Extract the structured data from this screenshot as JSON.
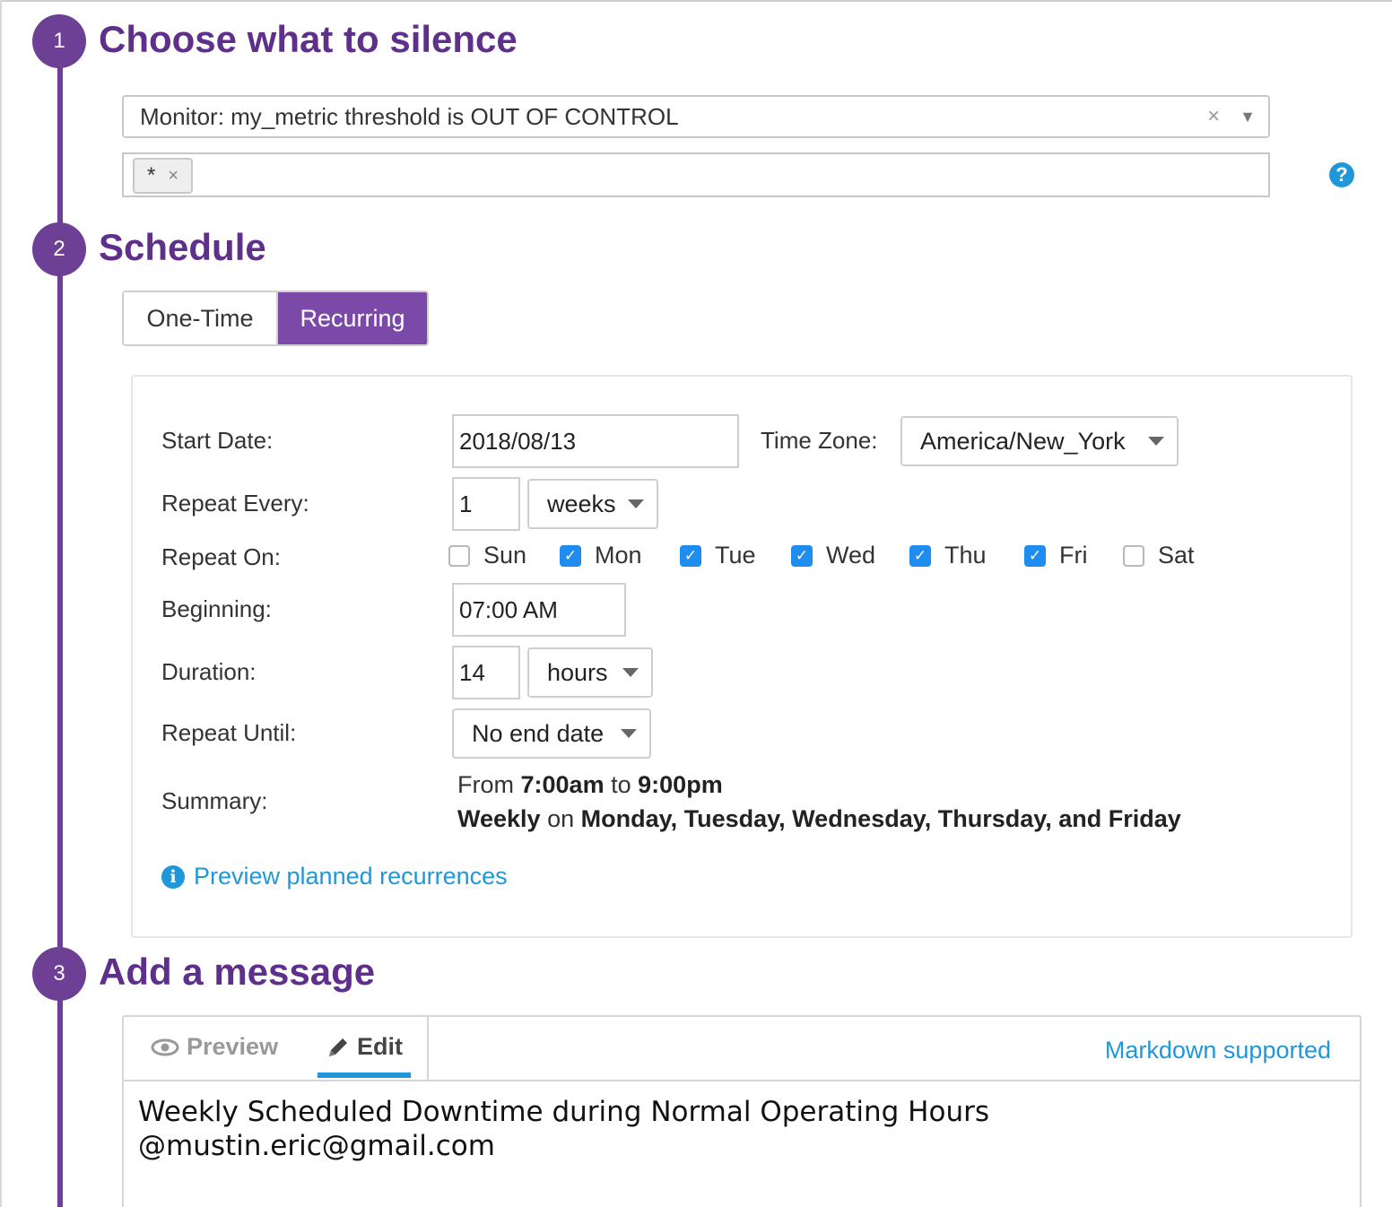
{
  "steps": [
    {
      "number": "1",
      "title": "Choose what to silence"
    },
    {
      "number": "2",
      "title": "Schedule"
    },
    {
      "number": "3",
      "title": "Add a message"
    }
  ],
  "silence": {
    "monitor_value": "Monitor: my_metric threshold is OUT OF CONTROL",
    "clear_icon": "×",
    "dropdown_icon": "▼",
    "scope_tag": "*",
    "scope_tag_remove": "×",
    "help_icon": "?"
  },
  "schedule": {
    "mode_tabs": [
      "One-Time",
      "Recurring"
    ],
    "active_tab": "Recurring",
    "labels": {
      "start_date": "Start Date:",
      "time_zone": "Time Zone:",
      "repeat_every": "Repeat Every:",
      "repeat_on": "Repeat On:",
      "beginning": "Beginning:",
      "duration": "Duration:",
      "repeat_until": "Repeat Until:",
      "summary": "Summary:"
    },
    "start_date": "2018/08/13",
    "time_zone": "America/New_York",
    "repeat_every_value": "1",
    "repeat_every_unit": "weeks",
    "days": [
      {
        "label": "Sun",
        "checked": false
      },
      {
        "label": "Mon",
        "checked": true
      },
      {
        "label": "Tue",
        "checked": true
      },
      {
        "label": "Wed",
        "checked": true
      },
      {
        "label": "Thu",
        "checked": true
      },
      {
        "label": "Fri",
        "checked": true
      },
      {
        "label": "Sat",
        "checked": false
      }
    ],
    "beginning": "07:00 AM",
    "duration_value": "14",
    "duration_unit": "hours",
    "repeat_until": "No end date",
    "summary": {
      "from": "From",
      "start_time": "7:00am",
      "to": "to",
      "end_time": "9:00pm",
      "frequency": "Weekly",
      "on": "on",
      "days_text": "Monday, Tuesday, Wednesday, Thursday, and Friday"
    },
    "preview_link": "Preview planned recurrences",
    "info_icon": "i"
  },
  "message": {
    "tabs": [
      "Preview",
      "Edit"
    ],
    "active_tab": "Edit",
    "markdown_link": "Markdown supported",
    "text_lines": [
      "Weekly Scheduled Downtime during Normal Operating Hours",
      "@mustin.eric@gmail.com"
    ]
  },
  "colors": {
    "brand_purple": "#6d3f95",
    "active_tab_purple": "#7b4aa8",
    "link_blue": "#1f97d9",
    "checkbox_blue": "#1f8cef"
  }
}
